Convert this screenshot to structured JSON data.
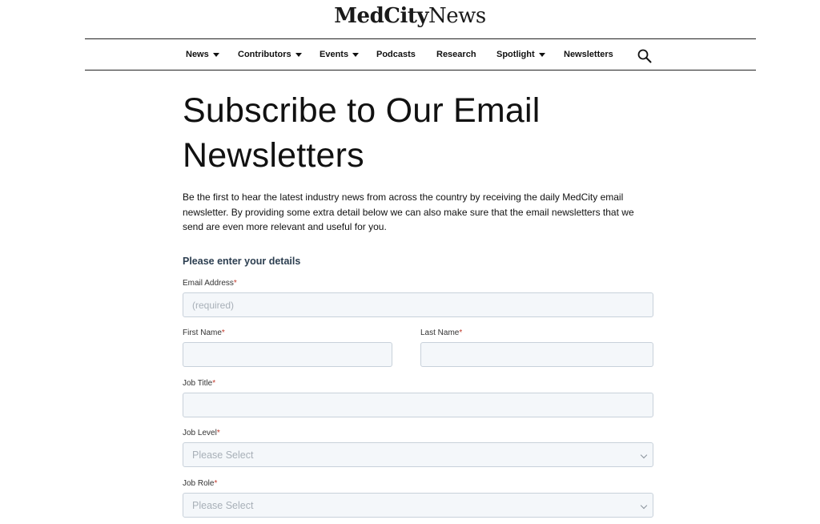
{
  "logo": {
    "part1": "MedCity",
    "part2": "News"
  },
  "nav": {
    "items": [
      {
        "label": "News"
      },
      {
        "label": "Contributors"
      },
      {
        "label": "Events"
      },
      {
        "label": "Podcasts"
      },
      {
        "label": "Research"
      },
      {
        "label": "Spotlight"
      },
      {
        "label": "Newsletters"
      }
    ],
    "search_icon": "search-icon"
  },
  "page": {
    "title": "Subscribe to Our Email Newsletters",
    "intro": "Be the first to hear the latest industry news from across the country by receiving the daily MedCity email newsletter. By providing some extra detail below we can also make sure that the email newsletters that we send are even more relevant and useful for you."
  },
  "form": {
    "section_title": "Please enter your details",
    "required_mark": "*",
    "email": {
      "label": "Email Address",
      "placeholder": "(required)",
      "value": ""
    },
    "first_name": {
      "label": "First Name",
      "placeholder": "",
      "value": ""
    },
    "last_name": {
      "label": "Last Name",
      "placeholder": "",
      "value": ""
    },
    "job_title": {
      "label": "Job Title",
      "placeholder": "",
      "value": ""
    },
    "job_level": {
      "label": "Job Level",
      "selected": "Please Select"
    },
    "job_role": {
      "label": "Job Role",
      "selected": "Please Select"
    }
  },
  "colors": {
    "required": "#c0392b",
    "field_bg": "#f4f7fa",
    "field_border": "#c8d1da",
    "section_title": "#2c3e50"
  }
}
